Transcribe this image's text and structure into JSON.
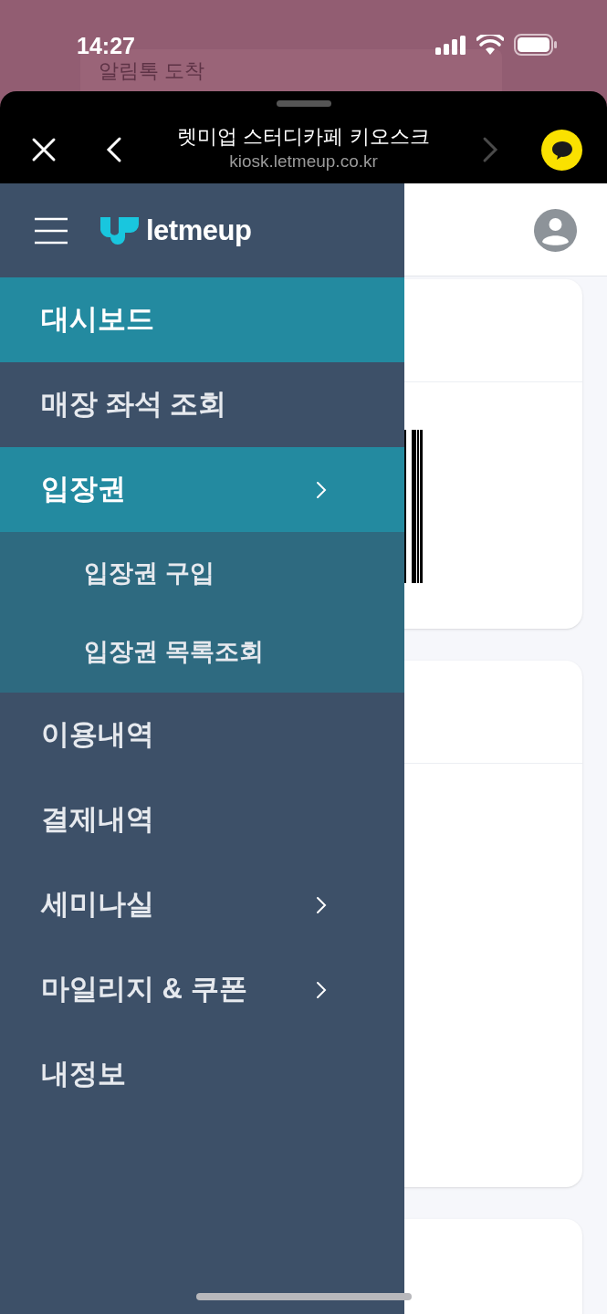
{
  "status_bar": {
    "time": "14:27"
  },
  "background_notification": {
    "text": "알림톡 도착"
  },
  "browser_bar": {
    "title": "렛미업 스터디카페 키오스크",
    "url": "kiosk.letmeup.co.kr",
    "forward_disabled": true
  },
  "app_header": {
    "logo_text": "letmeup"
  },
  "sidebar": {
    "items": [
      {
        "kind": "link",
        "label": "대시보드",
        "selected": true
      },
      {
        "kind": "link",
        "label": "매장 좌석 조회",
        "selected": false
      },
      {
        "kind": "group",
        "label": "입장권",
        "selected": true,
        "children": [
          {
            "label": "입장권 구입"
          },
          {
            "label": "입장권 목록조회"
          }
        ]
      },
      {
        "kind": "link",
        "label": "이용내역",
        "selected": false
      },
      {
        "kind": "link",
        "label": "결제내역",
        "selected": false
      },
      {
        "kind": "group",
        "label": "세미나실",
        "selected": false
      },
      {
        "kind": "group",
        "label": "마일리지 & 쿠폰",
        "selected": false
      },
      {
        "kind": "link",
        "label": "내정보",
        "selected": false
      }
    ]
  }
}
